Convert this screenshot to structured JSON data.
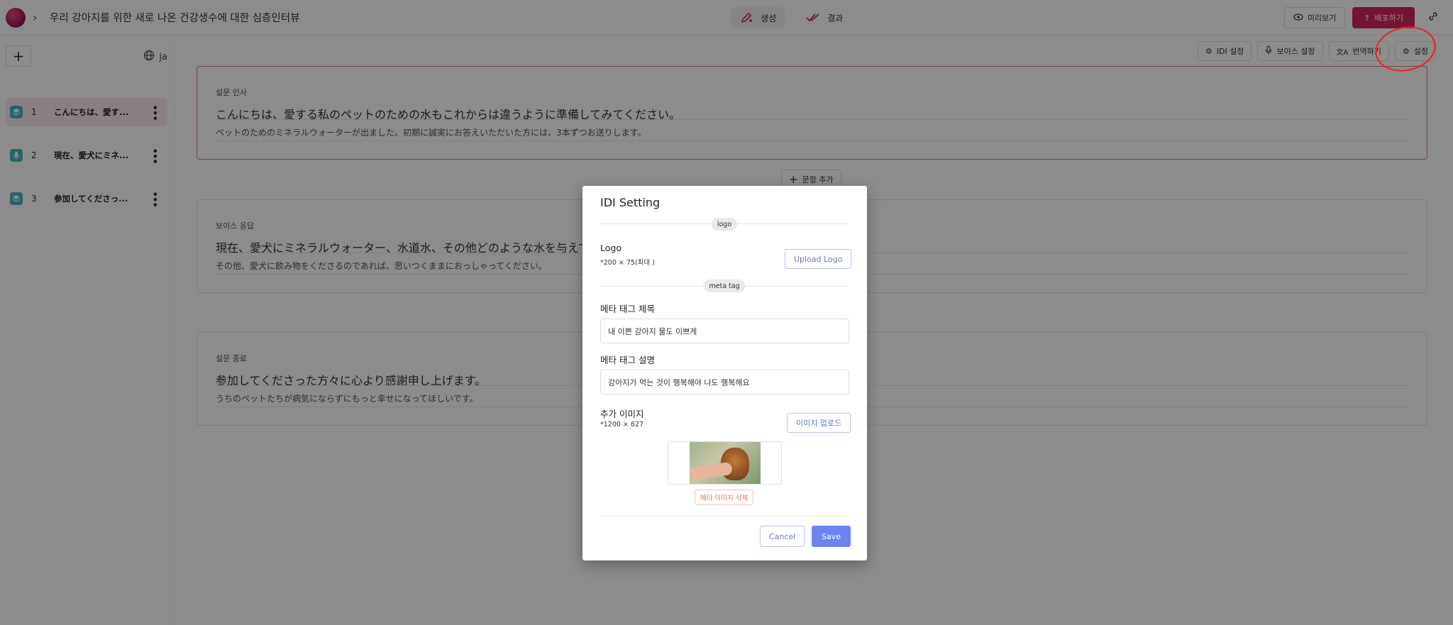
{
  "header": {
    "title": "우리 강아지를 위한 새로 나온 건강생수에 대한 심층인터뷰",
    "tabs": [
      {
        "label": "생성",
        "icon": "pen-icon"
      },
      {
        "label": "결과",
        "icon": "check-double-icon"
      }
    ],
    "preview_label": "미리보기",
    "publish_label": "배포하기"
  },
  "sidebar": {
    "language": "ja",
    "items": [
      {
        "num": "1",
        "label": "こんにちは、愛す...",
        "icon": "layers-icon"
      },
      {
        "num": "2",
        "label": "現在、愛犬にミネ...",
        "icon": "mic-icon"
      },
      {
        "num": "3",
        "label": "参加してくださっ...",
        "icon": "layers-icon"
      }
    ]
  },
  "toolbar": {
    "idi_label": "IDI 설정",
    "voice_label": "보이스 설정",
    "translate_label": "번역하기",
    "settings_label": "설정"
  },
  "cards": [
    {
      "label": "설문 인사",
      "question": "こんにちは、愛する私のペットのための水もこれからは違うように準備してみてください。",
      "sub": "ペットのためのミネラルウォーターが出ました。初期に誠実にお答えいただいた方には、3本ずつお送りします。"
    },
    {
      "label": "보이스 응답",
      "question": "現在、愛犬にミネラルウォーター、水道水、その他どのような水を与えてい",
      "sub": "その他、愛犬に飲み物をくださるのであれば、思いつくままにおっしゃってください。"
    },
    {
      "label": "설문 종료",
      "question": "参加してくださった方々に心より感謝申し上げます。",
      "sub": "うちのペットたちが病気にならずにもっと幸せになってほしいです。"
    }
  ],
  "add_question_label": "문항 추가",
  "modal": {
    "title": "IDI Setting",
    "logo_pill": "logo",
    "logo_label": "Logo",
    "logo_hint": "*200 × 75(최대 )",
    "upload_logo_label": "Upload Logo",
    "meta_pill": "meta tag",
    "meta_title_label": "메타 태그 제목",
    "meta_title_value": "내 이쁜 강아지 물도 이쁘게",
    "meta_desc_label": "메타 태그 설명",
    "meta_desc_value": "강아지가 먹는 것이 행복해야 나도 행복해요",
    "extra_image_label": "추가 이미지",
    "extra_image_hint": "*1200 × 627",
    "upload_image_label": "이미지 업로드",
    "delete_image_label": "메타 이미지 삭제",
    "cancel_label": "Cancel",
    "save_label": "Save"
  },
  "colors": {
    "brand": "#d6245c",
    "primary": "#6b84f2",
    "annotation": "#e22222"
  }
}
